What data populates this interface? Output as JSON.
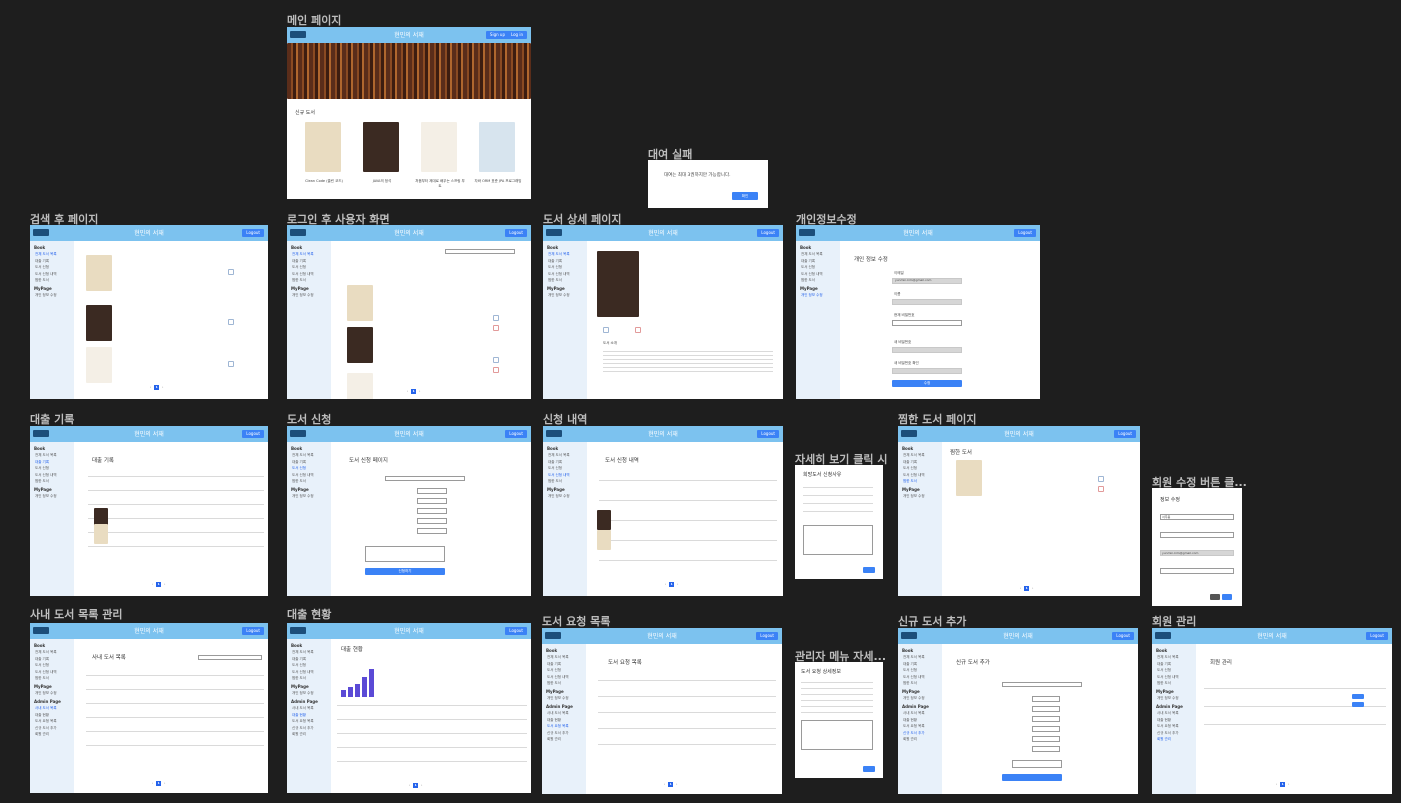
{
  "header": {
    "title": "현민의 서재",
    "logout": "Logout",
    "login": "Log in",
    "signup": "Sign up"
  },
  "sidebar": {
    "book_group": "Book",
    "book_items": [
      "전체 도서 목록",
      "대출 기록",
      "도서 신청",
      "도서 신청 내역",
      "찜한 도서"
    ],
    "mypage_group": "MyPage",
    "mypage_items": [
      "개인 정보 수정"
    ],
    "admin_group": "Admin Page",
    "admin_items": [
      "사내 도서 목록",
      "대출 현황",
      "도서 요청 목록",
      "신규 도서 추가",
      "회원 관리"
    ]
  },
  "frames": {
    "main": {
      "label": "메인 페이지",
      "new_books": "신규 도서",
      "books": [
        "Clean Code (클린 코드)",
        "JAVA의 정석",
        "처음부터 제대로 배우는 스프링 부트",
        "자바 ORM 표준 JPA 프로그래밍"
      ]
    },
    "fail": {
      "label": "대여 실패",
      "message": "대여는 최대 3권까지만 가능합니다.",
      "confirm": "확인"
    },
    "search": {
      "label": "검색 후 페이지"
    },
    "login": {
      "label": "로그인 후 사용자 화면"
    },
    "detail": {
      "label": "도서 상세 페이지",
      "desc_title": "도서 소개"
    },
    "profile": {
      "label": "개인정보수정",
      "title": "개인 정보 수정",
      "fields": [
        "이메일",
        "이름",
        "현재 비밀번호",
        "새 비밀번호",
        "새 비밀번호 확인"
      ],
      "email_value": "yunmin.kim@gmail.com",
      "name_value": "서주용",
      "submit": "수정"
    },
    "history": {
      "label": "대출 기록",
      "title": "대출 기록"
    },
    "request": {
      "label": "도서 신청",
      "title": "도서 신청 페이지",
      "submit": "신청하기"
    },
    "reqlist": {
      "label": "신청 내역",
      "title": "도서 신청 내역"
    },
    "reason": {
      "label": "자세히 보기 클릭 시",
      "title": "희망도서 신청사유"
    },
    "wish": {
      "label": "찜한 도서 페이지",
      "title": "찜한 도서"
    },
    "memberedit": {
      "label": "회원 수정 버튼 클...",
      "title": "정보 수정",
      "name_value": "서주용",
      "email_value": "yunmin.kim@gmail.com"
    },
    "inhouse": {
      "label": "사내 도서 목록 관리",
      "title": "사내 도서 목록"
    },
    "loans": {
      "label": "대출 현황",
      "title": "대출 현황"
    },
    "reqadmin": {
      "label": "도서 요청 목록",
      "title": "도서 요청 목록"
    },
    "admindetail": {
      "label": "관리자 메뉴 자세...",
      "title": "도서 요청 상세정보"
    },
    "newbook": {
      "label": "신규 도서 추가",
      "title": "신규 도서 추가"
    },
    "members": {
      "label": "회원 관리",
      "title": "회원 관리"
    }
  },
  "colors": {
    "header": "#7cc2ef",
    "accent": "#3b82f6",
    "sidebar": "#e8f1fa"
  }
}
